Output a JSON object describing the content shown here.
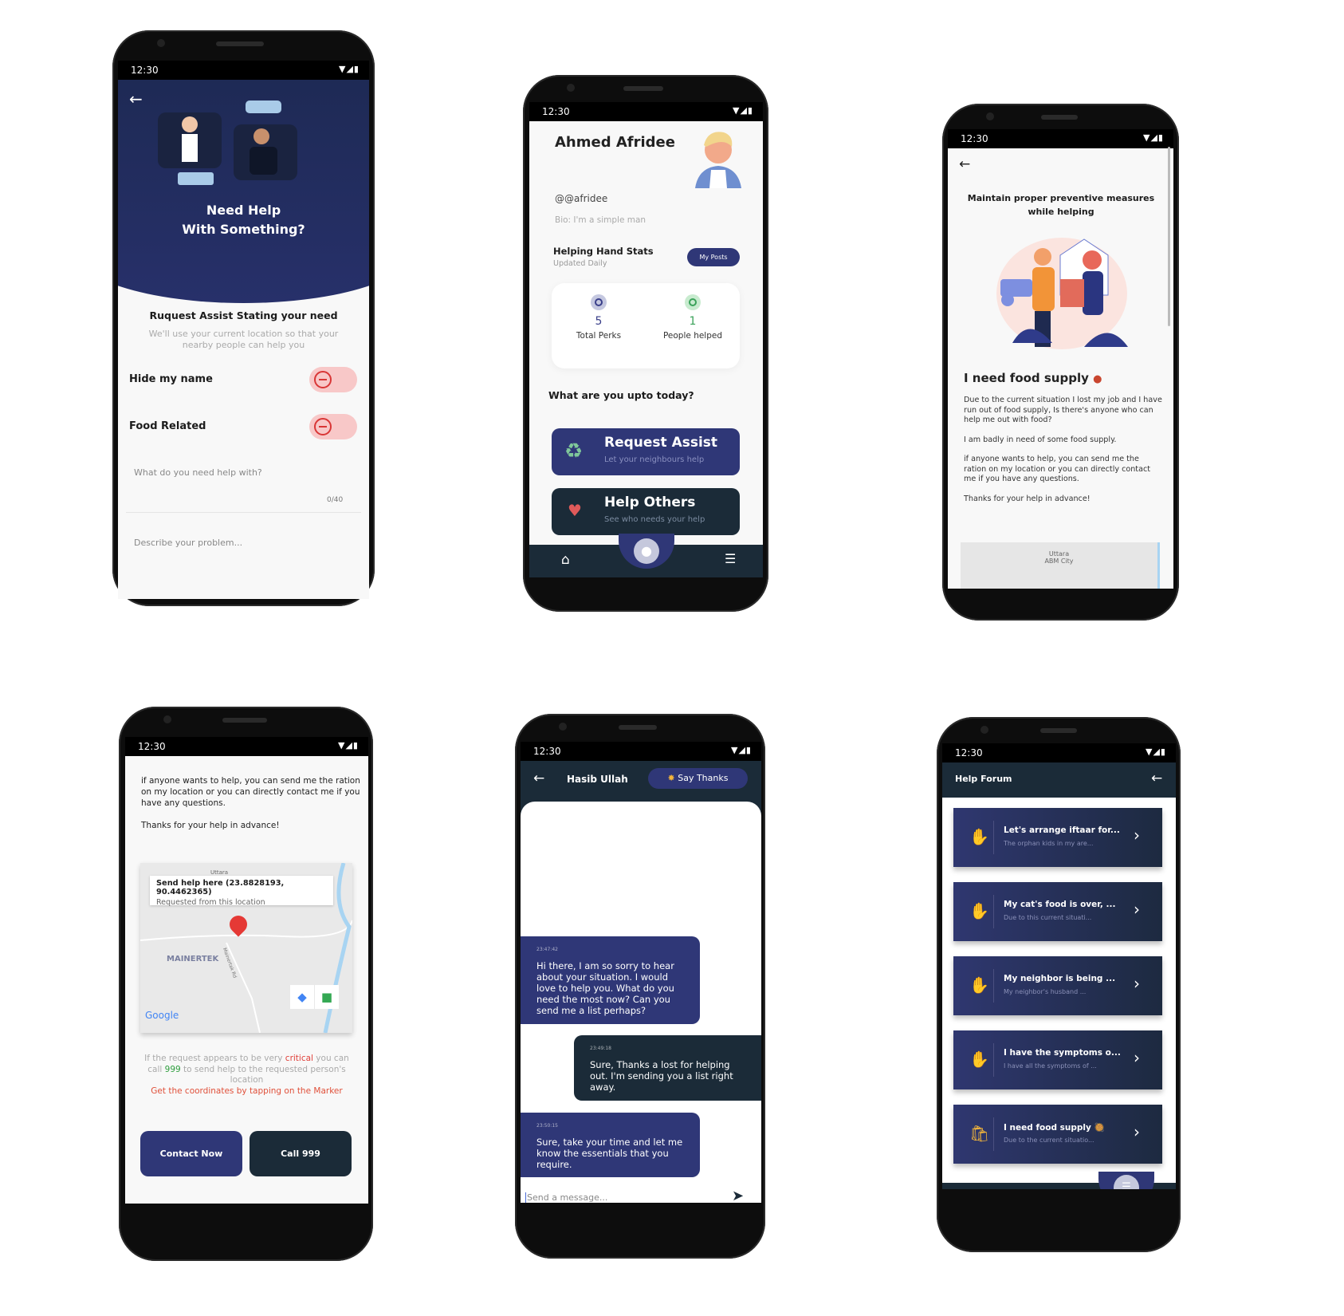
{
  "status": {
    "time": "12:30",
    "icons": "▼◢▮"
  },
  "help_request": {
    "title_line1": "Need Help",
    "title_line2": "With Something?",
    "heading": "Ruquest Assist Stating your need",
    "subtitle": "We'll use your current location so that your nearby people can help you",
    "toggles": [
      {
        "label": "Hide my name",
        "state": "off"
      },
      {
        "label": "Food Related",
        "state": "off"
      }
    ],
    "title_placeholder": "What do you need help with?",
    "counter": "0/40",
    "description_placeholder": "Describe your problem..."
  },
  "profile": {
    "name": "Ahmed Afridee",
    "handle": "@@afridee",
    "bio": "Bio: I'm a simple man",
    "stats_title": "Helping Hand Stats",
    "stats_sub": "Updated Daily",
    "my_posts": "My Posts",
    "stats": [
      {
        "value": "5",
        "label": "Total Perks",
        "color": "#3a3f8a"
      },
      {
        "value": "1",
        "label": "People helped",
        "color": "#3aa25a"
      }
    ],
    "question": "What are you upto today?",
    "actions": [
      {
        "title": "Request Assist",
        "sub": "Let your neighbours help",
        "color": "#2f3777"
      },
      {
        "title": "Help Others",
        "sub": "See who needs your help",
        "color": "#1b2b38"
      }
    ]
  },
  "post_detail": {
    "banner": "Maintain proper preventive measures while helping",
    "title": "I need food supply",
    "paragraphs": [
      "Due to the current situation I lost my job and I have run out of food supply, Is there's anyone who can help me out with food?",
      "I am badly in need of some food supply.",
      "if anyone wants to help, you can send me the ration on my location or you can directly contact me if you have any questions.",
      "Thanks for your help in advance!"
    ],
    "map_labels": [
      "Uttara",
      "ABM City"
    ]
  },
  "post_map": {
    "paragraphs": [
      "if anyone wants to help, you can send me the ration on my location or you can directly contact me if you have any questions.",
      "Thanks for your help in advance!"
    ],
    "map_top_label": "Uttara",
    "marker_title": "Send help here (23.8828193, 90.4462365)",
    "marker_sub": "Requested from this location",
    "area_label": "MAINERTEK",
    "road_label": "Mainertak Rd",
    "google": "Google",
    "info_a": "If the request appears to be very ",
    "info_critical": "critical",
    "info_b": " you can call ",
    "info_999": "999",
    "info_c": " to send help to the requested person's location",
    "info_red": "Get the coordinates by tapping on the Marker",
    "contact_button": "Contact Now",
    "call_button": "Call 999"
  },
  "chat": {
    "contact": "Hasib Ullah",
    "say_thanks": "Say Thanks",
    "messages": [
      {
        "time": "23:47:42",
        "text": "Hi there, I am so sorry to hear about your situation. I would love to help you. What do you need the most now? Can you send me a list perhaps?",
        "side": "left"
      },
      {
        "time": "23:49:18",
        "text": "Sure, Thanks a lost for helping out. I'm sending you a list right away.",
        "side": "right"
      },
      {
        "time": "23:50:15",
        "text": " Sure, take your time and let me know the essentials that you require.",
        "side": "left"
      }
    ],
    "input_placeholder": "Send a message..."
  },
  "forum": {
    "title": "Help Forum",
    "posts": [
      {
        "title": "Let's arrange iftaar for...",
        "sub": "The orphan kids in my are...",
        "icon": "helping-hand-icon"
      },
      {
        "title": "My cat's food is over, ...",
        "sub": "Due to this current situati...",
        "icon": "helping-hand-icon"
      },
      {
        "title": "My neighbor is being ...",
        "sub": "My neighbor's husband ...",
        "icon": "helping-hand-icon"
      },
      {
        "title": "I have the symptoms o...",
        "sub": "I have all the symptoms of ...",
        "icon": "helping-hand-icon"
      },
      {
        "title": "I need food supply 🥘",
        "sub": "Due to the current situatio...",
        "icon": "grocery-bag-icon"
      }
    ]
  },
  "colors": {
    "navy": "#2f3777",
    "dark": "#1b2b38",
    "critical": "#e0403a",
    "green": "#2e9e3e"
  }
}
